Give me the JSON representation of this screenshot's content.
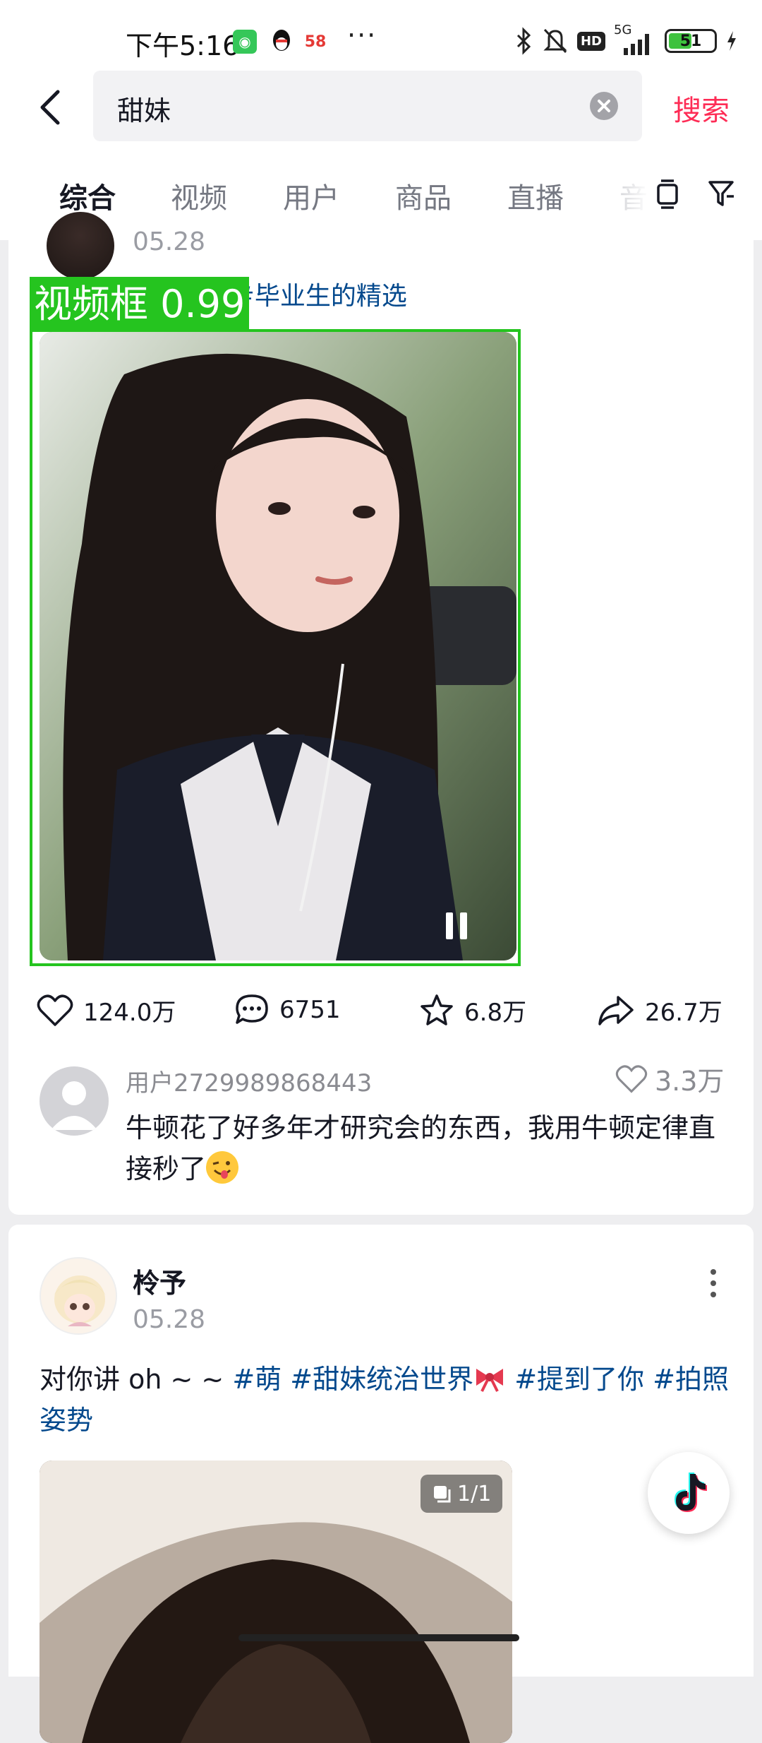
{
  "status_bar": {
    "time": "下午5:16",
    "app_icon_58": "58",
    "overflow": "···",
    "hd": "HD",
    "network": "5G",
    "battery": "51"
  },
  "header": {
    "search_value": "甜妹",
    "search_button": "搜索"
  },
  "tabs": [
    {
      "label": "综合",
      "active": true
    },
    {
      "label": "视频"
    },
    {
      "label": "用户"
    },
    {
      "label": "商品"
    },
    {
      "label": "直播"
    },
    {
      "label": "音"
    }
  ],
  "post1": {
    "date": "05.28",
    "hashtags": "妹 #校园 #校服 #毕业生的精选",
    "detection_label": "视频框 0.99",
    "stats": {
      "likes": "124.0万",
      "comments": "6751",
      "favorites": "6.8万",
      "shares": "26.7万"
    },
    "top_comment": {
      "user": "用户2729989868443",
      "likes": "3.3万",
      "text": "牛顿花了好多年才研究会的东西，我用牛顿定律直接秒了"
    }
  },
  "post2": {
    "author": "柃予",
    "date": "05.28",
    "text_plain": "对你讲 oh ~ ~ ",
    "tags": [
      "#萌",
      "#甜妹统治世界",
      "#提到了你",
      "#拍照姿势"
    ],
    "image_count": "1/1"
  },
  "colors": {
    "accent": "#fe2c55",
    "hashtag": "#04498d",
    "detection": "#25c41f"
  }
}
